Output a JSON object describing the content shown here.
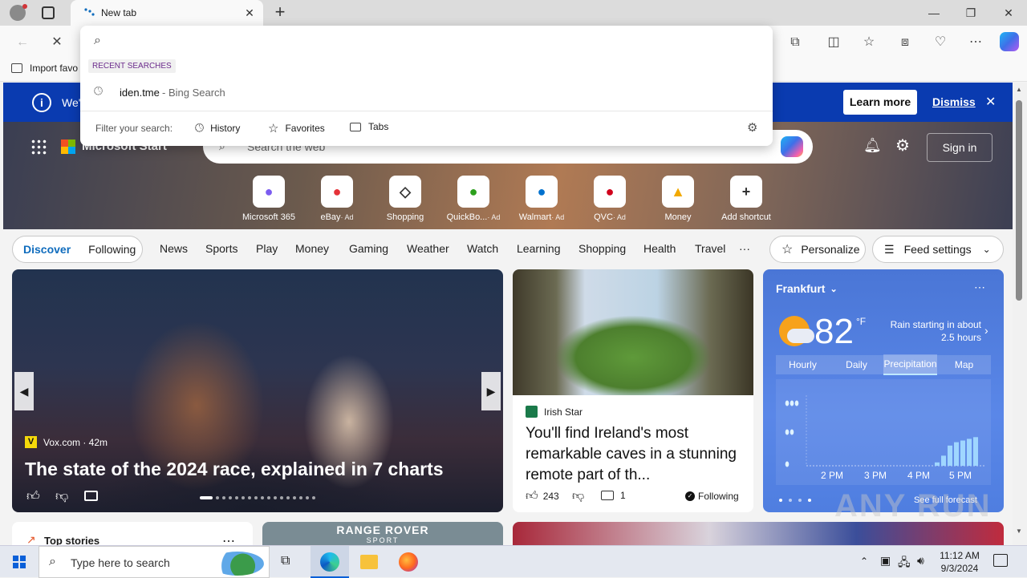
{
  "browser": {
    "tab_title": "New tab",
    "back_icon": "back-arrow-icon",
    "reload_icon": "stop-icon"
  },
  "favorites_bar": {
    "import_label": "Import favo"
  },
  "omnibox": {
    "value": "",
    "section_label": "RECENT SEARCHES",
    "recent": [
      {
        "query": "iden.tme",
        "source": " - Bing Search"
      }
    ],
    "filter_label": "Filter your search:",
    "filters": [
      "History",
      "Favorites",
      "Tabs"
    ]
  },
  "banner": {
    "text": "We'",
    "learn_more": "Learn more",
    "dismiss": "Dismiss"
  },
  "header": {
    "brand": "Microsoft Start",
    "search_placeholder": "Search the web",
    "sign_in": "Sign in"
  },
  "shortcuts": [
    {
      "label": "Microsoft 365",
      "ad": "",
      "icon": "m365-icon",
      "color": "#7b5cf0"
    },
    {
      "label": "eBay",
      "ad": "· Ad",
      "icon": "ebay-bag-icon",
      "color": "#e53238"
    },
    {
      "label": "Shopping",
      "ad": "",
      "icon": "tag-icon",
      "color": "#333333"
    },
    {
      "label": "QuickBo...",
      "ad": "· Ad",
      "icon": "quickbooks-icon",
      "color": "#2ca01c"
    },
    {
      "label": "Walmart",
      "ad": "· Ad",
      "icon": "walmart-icon",
      "color": "#0071ce"
    },
    {
      "label": "QVC",
      "ad": "· Ad",
      "icon": "qvc-icon",
      "color": "#d0021b"
    },
    {
      "label": "Money",
      "ad": "",
      "icon": "chart-icon",
      "color": "#f2a900"
    },
    {
      "label": "Add shortcut",
      "ad": "",
      "icon": "plus-icon",
      "color": "#333333"
    }
  ],
  "feed_tabs": {
    "discover": "Discover",
    "following": "Following"
  },
  "nav": [
    "News",
    "Sports",
    "Play",
    "Money",
    "Gaming",
    "Weather",
    "Watch",
    "Learning",
    "Shopping",
    "Health",
    "Travel",
    "···"
  ],
  "personalize": "Personalize",
  "feed_settings": "Feed settings",
  "main_story": {
    "source": "Vox.com · 42m",
    "title": "The state of the 2024 race, explained in 7 charts"
  },
  "side_story": {
    "source": "Irish Star",
    "title": "You'll find Ireland's most remarkable caves in a stunning remote part of th...",
    "likes": "243",
    "comments": "1",
    "following": "Following"
  },
  "weather": {
    "city": "Frankfurt",
    "temp": "82",
    "unit": "°F",
    "alert": "Rain starting in about 2.5 hours",
    "tabs": [
      "Hourly",
      "Daily",
      "Precipitation",
      "Map"
    ],
    "active_tab": 2,
    "times": [
      "2 PM",
      "3 PM",
      "4 PM",
      "5 PM"
    ],
    "full_forecast": "See full forecast"
  },
  "bottom": {
    "top_stories": "Top stories",
    "ad_text": "RANGE ROVER",
    "ad_sub": "SPORT"
  },
  "taskbar": {
    "search_placeholder": "Type here to search",
    "time": "11:12 AM",
    "date": "9/3/2024"
  },
  "watermark": "ANY RUN",
  "colors": {
    "banner": "#0a3bb0",
    "accent": "#0f6cbd",
    "weather_bg": "#4f7ee0"
  }
}
